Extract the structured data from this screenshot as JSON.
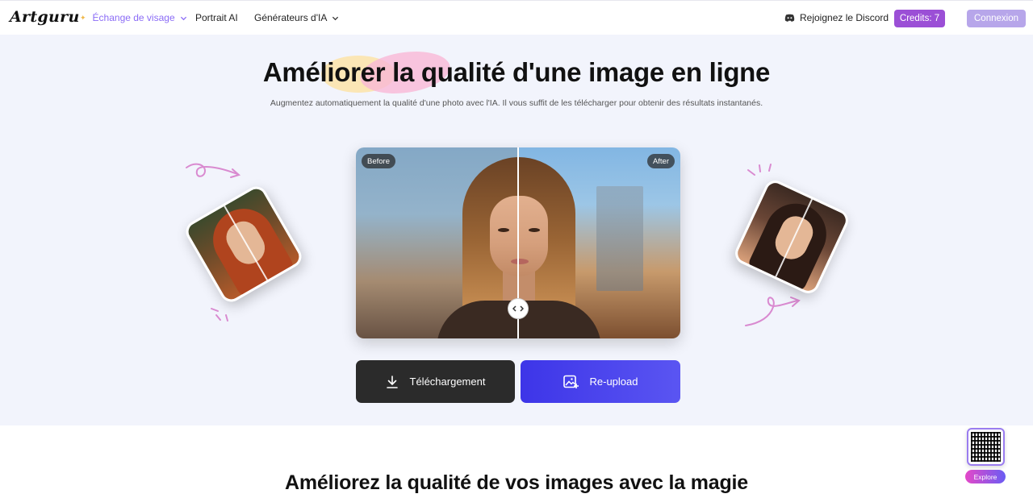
{
  "nav": {
    "logo": "Artguru",
    "items": [
      {
        "label": "Échange de visage",
        "active": true,
        "dropdown": true
      },
      {
        "label": "Portrait AI",
        "active": false,
        "dropdown": false
      },
      {
        "label": "Générateurs d'IA",
        "active": false,
        "dropdown": true
      }
    ],
    "discord": "Rejoignez le Discord",
    "credits": "Credits: 7",
    "login": "Connexion"
  },
  "hero": {
    "title": "Améliorer la qualité d'une image en ligne",
    "subtitle": "Augmentez automatiquement la qualité d'une photo avec l'IA. Il vous suffit de les télécharger pour obtenir des résultats instantanés.",
    "before_label": "Before",
    "after_label": "After",
    "download_label": "Téléchargement",
    "reupload_label": "Re-upload"
  },
  "section2": {
    "title": "Améliorez la qualité de vos images avec la magie"
  },
  "widget": {
    "explore_label": "Explore"
  },
  "colors": {
    "accent": "#8b6cf6",
    "credits_bg": "#9b4fd6",
    "login_bg": "#b7a6ea",
    "reupload_bg": "#3d35e8",
    "download_bg": "#2b2b2b",
    "hero_bg": "#f2f4fc"
  },
  "icons": [
    "chevron-down-icon",
    "discord-icon",
    "download-icon",
    "image-upload-icon",
    "compare-arrows-icon",
    "qr-code-icon"
  ]
}
